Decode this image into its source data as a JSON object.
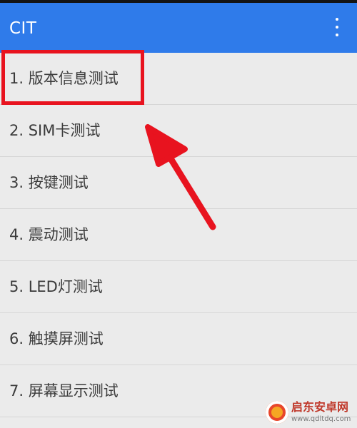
{
  "app_bar": {
    "title": "CIT",
    "overflow_icon": "more-vert-icon",
    "color": "#2f7bea"
  },
  "list": {
    "items": [
      {
        "label": "1. 版本信息测试"
      },
      {
        "label": "2. SIM卡测试"
      },
      {
        "label": "3. 按键测试"
      },
      {
        "label": "4. 震动测试"
      },
      {
        "label": "5. LED灯测试"
      },
      {
        "label": "6. 触摸屏测试"
      },
      {
        "label": "7. 屏幕显示测试"
      }
    ]
  },
  "annotation": {
    "highlight_color": "#e8131f",
    "highlighted_item": "1. 版本信息测试"
  },
  "watermark": {
    "text": "启东安卓网",
    "url": "www.qdltdq.com"
  }
}
